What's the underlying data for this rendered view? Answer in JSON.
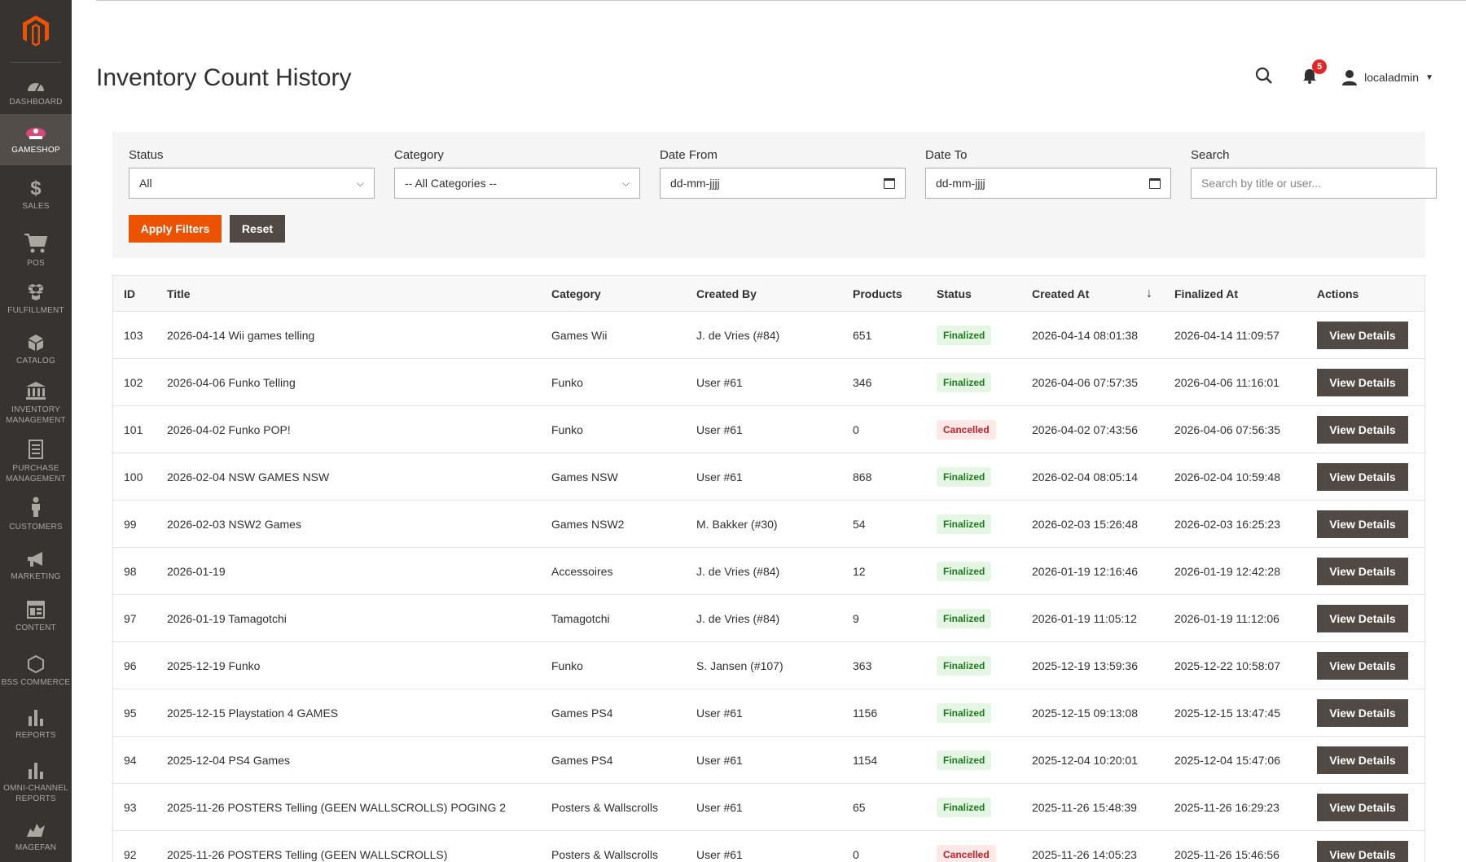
{
  "sidebar": {
    "items": [
      {
        "label": "DASHBOARD",
        "icon": "dashboard-icon"
      },
      {
        "label": "GAMESHOP",
        "icon": "gameshop-icon"
      },
      {
        "label": "SALES",
        "icon": "dollar-icon"
      },
      {
        "label": "POS",
        "icon": "cart-icon"
      },
      {
        "label": "FULFILLMENT",
        "icon": "boxes-icon"
      },
      {
        "label": "CATALOG",
        "icon": "cube-icon"
      },
      {
        "label": "INVENTORY MANAGEMENT",
        "icon": "bank-icon"
      },
      {
        "label": "PURCHASE MANAGEMENT",
        "icon": "document-icon"
      },
      {
        "label": "CUSTOMERS",
        "icon": "person-icon"
      },
      {
        "label": "MARKETING",
        "icon": "megaphone-icon"
      },
      {
        "label": "CONTENT",
        "icon": "layout-icon"
      },
      {
        "label": "BSS COMMERCE",
        "icon": "hexagon-icon"
      },
      {
        "label": "REPORTS",
        "icon": "bar-chart-icon"
      },
      {
        "label": "OMNI-CHANNEL REPORTS",
        "icon": "bar-chart-icon"
      },
      {
        "label": "MAGEFAN",
        "icon": "magefan-icon"
      }
    ],
    "active": "GAMESHOP"
  },
  "header": {
    "title": "Inventory Count History",
    "notifications_count": "5",
    "username": "localadmin"
  },
  "filters": {
    "status_label": "Status",
    "status_value": "All",
    "category_label": "Category",
    "category_value": "-- All Categories --",
    "date_from_label": "Date From",
    "date_from_value": "dd-mm-jjjj",
    "date_to_label": "Date To",
    "date_to_value": "dd-mm-jjjj",
    "search_label": "Search",
    "search_placeholder": "Search by title or user...",
    "apply_label": "Apply Filters",
    "reset_label": "Reset"
  },
  "table": {
    "columns": [
      "ID",
      "Title",
      "Category",
      "Created By",
      "Products",
      "Status",
      "Created At",
      "Finalized At",
      "Actions"
    ],
    "sort_indicator": "↓",
    "action_label": "View Details",
    "rows": [
      {
        "id": "103",
        "title": "2026-04-14 Wii games telling",
        "category": "Games Wii",
        "created_by": "J. de Vries (#84)",
        "products": "651",
        "status": "Finalized",
        "created_at": "2026-04-14 08:01:38",
        "finalized_at": "2026-04-14 11:09:57"
      },
      {
        "id": "102",
        "title": "2026-04-06 Funko Telling",
        "category": "Funko",
        "created_by": "User #61",
        "products": "346",
        "status": "Finalized",
        "created_at": "2026-04-06 07:57:35",
        "finalized_at": "2026-04-06 11:16:01"
      },
      {
        "id": "101",
        "title": "2026-04-02 Funko POP!",
        "category": "Funko",
        "created_by": "User #61",
        "products": "0",
        "status": "Cancelled",
        "created_at": "2026-04-02 07:43:56",
        "finalized_at": "2026-04-06 07:56:35"
      },
      {
        "id": "100",
        "title": "2026-02-04 NSW GAMES NSW",
        "category": "Games NSW",
        "created_by": "User #61",
        "products": "868",
        "status": "Finalized",
        "created_at": "2026-02-04 08:05:14",
        "finalized_at": "2026-02-04 10:59:48"
      },
      {
        "id": "99",
        "title": "2026-02-03 NSW2 Games",
        "category": "Games NSW2",
        "created_by": "M. Bakker (#30)",
        "products": "54",
        "status": "Finalized",
        "created_at": "2026-02-03 15:26:48",
        "finalized_at": "2026-02-03 16:25:23"
      },
      {
        "id": "98",
        "title": "2026-01-19",
        "category": "Accessoires",
        "created_by": "J. de Vries (#84)",
        "products": "12",
        "status": "Finalized",
        "created_at": "2026-01-19 12:16:46",
        "finalized_at": "2026-01-19 12:42:28"
      },
      {
        "id": "97",
        "title": "2026-01-19 Tamagotchi",
        "category": "Tamagotchi",
        "created_by": "J. de Vries (#84)",
        "products": "9",
        "status": "Finalized",
        "created_at": "2026-01-19 11:05:12",
        "finalized_at": "2026-01-19 11:12:06"
      },
      {
        "id": "96",
        "title": "2025-12-19 Funko",
        "category": "Funko",
        "created_by": "S. Jansen (#107)",
        "products": "363",
        "status": "Finalized",
        "created_at": "2025-12-19 13:59:36",
        "finalized_at": "2025-12-22 10:58:07"
      },
      {
        "id": "95",
        "title": "2025-12-15 Playstation 4 GAMES",
        "category": "Games PS4",
        "created_by": "User #61",
        "products": "1156",
        "status": "Finalized",
        "created_at": "2025-12-15 09:13:08",
        "finalized_at": "2025-12-15 13:47:45"
      },
      {
        "id": "94",
        "title": "2025-12-04 PS4 Games",
        "category": "Games PS4",
        "created_by": "User #61",
        "products": "1154",
        "status": "Finalized",
        "created_at": "2025-12-04 10:20:01",
        "finalized_at": "2025-12-04 15:47:06"
      },
      {
        "id": "93",
        "title": "2025-11-26 POSTERS Telling (GEEN WALLSCROLLS) POGING 2",
        "category": "Posters & Wallscrolls",
        "created_by": "User #61",
        "products": "65",
        "status": "Finalized",
        "created_at": "2025-11-26 15:48:39",
        "finalized_at": "2025-11-26 16:29:23"
      },
      {
        "id": "92",
        "title": "2025-11-26 POSTERS Telling (GEEN WALLSCROLLS)",
        "category": "Posters & Wallscrolls",
        "created_by": "User #61",
        "products": "0",
        "status": "Cancelled",
        "created_at": "2025-11-26 14:05:23",
        "finalized_at": "2025-11-26 15:46:56"
      }
    ]
  },
  "colors": {
    "sidebar_bg": "#373330",
    "accent": "#eb5202",
    "button_dark": "#514943",
    "finalized": "#1f7a1f",
    "cancelled": "#c0232c"
  }
}
